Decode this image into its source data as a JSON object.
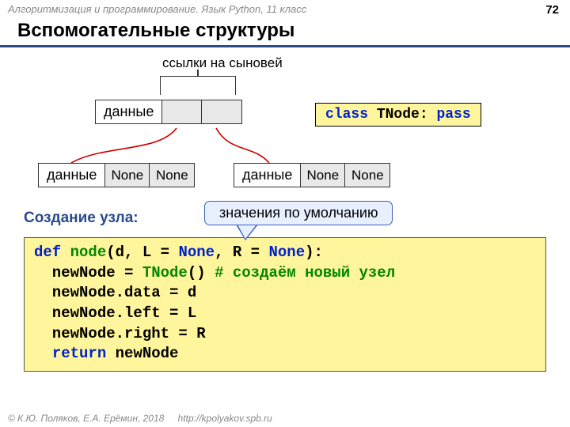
{
  "header": {
    "course": "Алгоритмизация и программирование. Язык Python, 11 класс",
    "page": "72"
  },
  "title": "Вспомогательные структуры",
  "labels": {
    "sons": "ссылки на сыновей",
    "create": "Создание узла:",
    "callout": "значения по умолчанию"
  },
  "nodes": {
    "top": {
      "data": "данные"
    },
    "left": {
      "data": "данные",
      "l": "None",
      "r": "None"
    },
    "right": {
      "data": "данные",
      "l": "None",
      "r": "None"
    }
  },
  "classcode": {
    "kw": "class",
    "name": " TNode: ",
    "pass": "pass"
  },
  "code": {
    "l1_def": "def",
    "l1_fn": " node",
    "l1_sig1": "(d, L = ",
    "l1_none1": "None",
    "l1_sig2": ", R = ",
    "l1_none2": "None",
    "l1_sig3": "):",
    "l2a": "  newNode = ",
    "l2b": "TNode",
    "l2c": "() ",
    "l2cm": "# создаём новый узел",
    "l3": "  newNode.data = d",
    "l4": "  newNode.left = L",
    "l5": "  newNode.right = R",
    "l6a": "  ",
    "l6b": "return",
    "l6c": " newNode"
  },
  "footer": {
    "copy": "© К.Ю. Поляков, Е.А. Ерёмин, 2018",
    "url": "http://kpolyakov.spb.ru"
  }
}
